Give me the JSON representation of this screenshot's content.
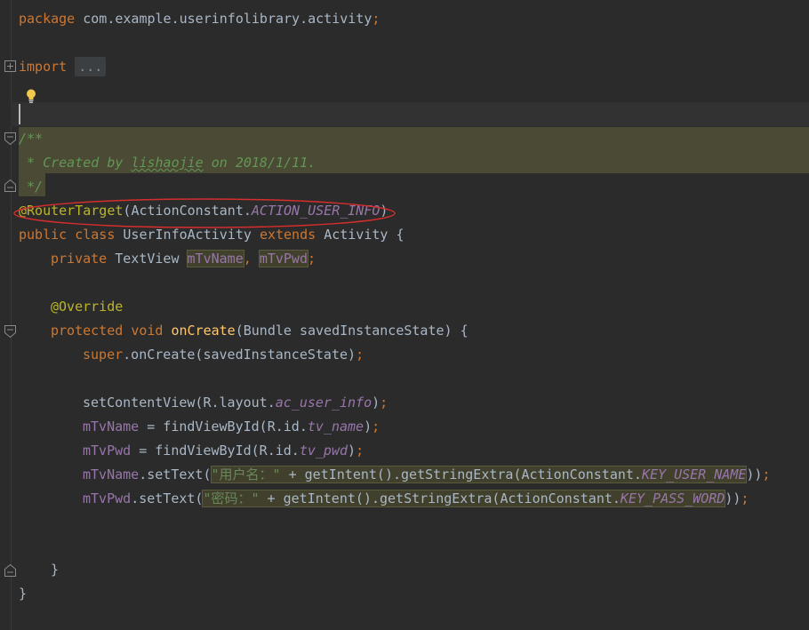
{
  "code": {
    "package_kw": "package",
    "package_name": "com.example.userinfolibrary.activity",
    "semi": ";",
    "import_kw": "import",
    "import_fold": "...",
    "doc_open": "/**",
    "doc_line_prefix": " * Created by ",
    "doc_author": "lishaojie",
    "doc_line_suffix": " on 2018/1/11.",
    "doc_close": " */",
    "annotation": "@RouterTarget",
    "paren_open": "(",
    "paren_close": ")",
    "action_class": "ActionConstant.",
    "action_const": "ACTION_USER_INFO",
    "class_modifiers": "public class ",
    "class_name": "UserInfoActivity ",
    "extends_kw": "extends ",
    "super_class": "Activity {",
    "private_kw": "private ",
    "field_type": "TextView ",
    "field_name1": "mTvName",
    "comma": ", ",
    "field_name2": "mTvPwd",
    "override": "@Override",
    "protected_kw": "protected ",
    "void_kw": "void ",
    "method_name": "onCreate",
    "method_params": "(Bundle savedInstanceState) {",
    "super_kw": "super",
    "super_call": ".onCreate(savedInstanceState)",
    "set_content": "setContentView(R.layout.",
    "layout_const": "ac_user_info",
    "var1": "mTvName",
    "assign": " = findViewById(R.id.",
    "id_name": "tv_name",
    "var2": "mTvPwd",
    "id_pwd": "tv_pwd",
    "set_text": ".setText(",
    "str_username": "\"用户名：\"",
    "plus_intent": " + getIntent().getStringExtra(ActionConstant.",
    "key_user_name": "KEY_USER_NAME",
    "str_password": "\"密码：\"",
    "key_pass_word": "KEY_PASS_WORD",
    "close_paren2": "))",
    "close_brace": "}"
  }
}
